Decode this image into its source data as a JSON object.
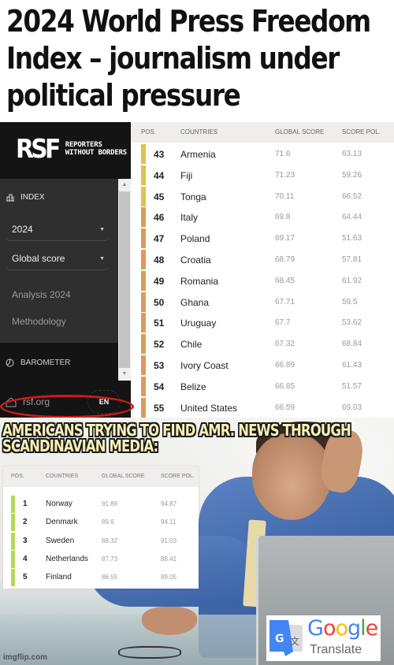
{
  "headline": {
    "line1": "2024 World Press Freedom",
    "line2": "Index – journalism under",
    "line3": "political pressure"
  },
  "rsf": {
    "logo": {
      "mark": "RSF",
      "text_line1": "REPORTERS",
      "text_line2": "WITHOUT BORDERS"
    },
    "sidebar": {
      "index_label": "INDEX",
      "year_select": "2024",
      "score_select": "Global score",
      "links": [
        "Analysis 2024",
        "Methodology"
      ],
      "barometer_label": "BAROMETER",
      "site_link": "rsf.org",
      "language": "EN"
    },
    "table": {
      "headers": {
        "pos": "POS.",
        "countries": "COUNTRIES",
        "global_score": "GLOBAL SCORE",
        "score_pol": "SCORE POL."
      },
      "rows": [
        {
          "pos": "43",
          "country": "Armenia",
          "global": "71.6",
          "pol": "63.13",
          "color": "#e3c14a"
        },
        {
          "pos": "44",
          "country": "Fiji",
          "global": "71.23",
          "pol": "59.26",
          "color": "#e3c14a"
        },
        {
          "pos": "45",
          "country": "Tonga",
          "global": "70.11",
          "pol": "66.52",
          "color": "#e3c14a"
        },
        {
          "pos": "46",
          "country": "Italy",
          "global": "69.8",
          "pol": "64.44",
          "color": "#dc9a5a"
        },
        {
          "pos": "47",
          "country": "Poland",
          "global": "69.17",
          "pol": "51.63",
          "color": "#dc9a5a"
        },
        {
          "pos": "48",
          "country": "Croatia",
          "global": "68.79",
          "pol": "57.81",
          "color": "#dc9a5a"
        },
        {
          "pos": "49",
          "country": "Romania",
          "global": "68.45",
          "pol": "61.92",
          "color": "#dc9a5a"
        },
        {
          "pos": "50",
          "country": "Ghana",
          "global": "67.71",
          "pol": "59.5",
          "color": "#dc9a5a"
        },
        {
          "pos": "51",
          "country": "Uruguay",
          "global": "67.7",
          "pol": "53.62",
          "color": "#dc9a5a"
        },
        {
          "pos": "52",
          "country": "Chile",
          "global": "67.32",
          "pol": "68.84",
          "color": "#dc9a5a"
        },
        {
          "pos": "53",
          "country": "Ivory Coast",
          "global": "66.89",
          "pol": "61.43",
          "color": "#dc9a5a"
        },
        {
          "pos": "54",
          "country": "Belize",
          "global": "66.85",
          "pol": "51.57",
          "color": "#dc9a5a"
        },
        {
          "pos": "55",
          "country": "United States",
          "global": "66.59",
          "pol": "69.03",
          "color": "#dc9a5a"
        }
      ],
      "highlighted_country": "United States",
      "highlight_color": "#d11a1a"
    }
  },
  "meme": {
    "caption_line1": "AMERICANS TRYING TO FIND AMR. NEWS THROUGH",
    "caption_line2": "SCANDINAVIAN MEDIA:",
    "mini_table": {
      "headers": {
        "pos": "POS.",
        "countries": "COUNTRIES",
        "global_score": "GLOBAL SCORE",
        "score_pol": "SCORE POL."
      },
      "rows": [
        {
          "pos": "1",
          "country": "Norway",
          "global": "91.89",
          "pol": "94.87"
        },
        {
          "pos": "2",
          "country": "Denmark",
          "global": "89.6",
          "pol": "94.11"
        },
        {
          "pos": "3",
          "country": "Sweden",
          "global": "88.32",
          "pol": "91.03"
        },
        {
          "pos": "4",
          "country": "Netherlands",
          "global": "87.73",
          "pol": "88.41"
        },
        {
          "pos": "5",
          "country": "Finland",
          "global": "86.55",
          "pol": "89.05"
        }
      ],
      "bar_color": "#b7d75c"
    },
    "google_translate": {
      "word_google": [
        "G",
        "o",
        "o",
        "g",
        "l",
        "e"
      ],
      "google_colors": [
        "#4285f4",
        "#ea4335",
        "#fbbc05",
        "#4285f4",
        "#34a853",
        "#ea4335"
      ],
      "word_translate": "Translate",
      "icon_letters": {
        "latin": "G",
        "cjk": "文"
      }
    },
    "watermark": "imgflip.com"
  }
}
